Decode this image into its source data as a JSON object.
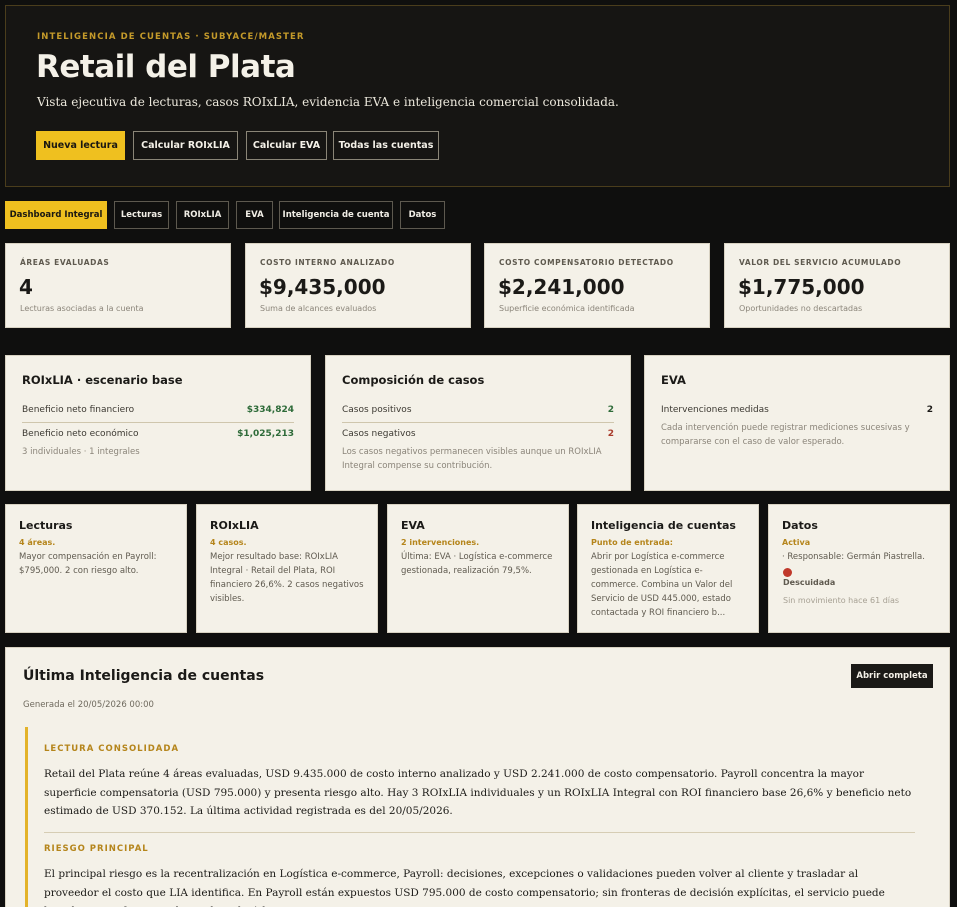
{
  "header": {
    "eyebrow": "INTELIGENCIA DE CUENTAS · SUBYACE/MASTER",
    "title": "Retail del Plata",
    "subtitle": "Vista ejecutiva de lecturas, casos ROIxLIA, evidencia EVA e inteligencia comercial consolidada.",
    "buttons": [
      "Nueva lectura",
      "Calcular ROIxLIA",
      "Calcular EVA",
      "Todas las cuentas"
    ]
  },
  "tabs": [
    "Dashboard Integral",
    "Lecturas",
    "ROIxLIA",
    "EVA",
    "Inteligencia de cuenta",
    "Datos"
  ],
  "kpis": [
    {
      "label": "ÁREAS EVALUADAS",
      "value": "4",
      "note": "Lecturas asociadas a la cuenta"
    },
    {
      "label": "COSTO INTERNO ANALIZADO",
      "value": "$9,435,000",
      "note": "Suma de alcances evaluados"
    },
    {
      "label": "COSTO COMPENSATORIO DETECTADO",
      "value": "$2,241,000",
      "note": "Superficie económica identificada"
    },
    {
      "label": "VALOR DEL SERVICIO ACUMULADO",
      "value": "$1,775,000",
      "note": "Oportunidades no descartadas"
    }
  ],
  "roi_card": {
    "title": "ROIxLIA · escenario base",
    "rows": [
      {
        "label": "Beneficio neto financiero",
        "value": "$334,824"
      },
      {
        "label": "Beneficio neto económico",
        "value": "$1,025,213"
      }
    ],
    "note": "3 individuales · 1 integrales"
  },
  "cases_card": {
    "title": "Composición de casos",
    "rows": [
      {
        "label": "Casos positivos",
        "value": "2"
      },
      {
        "label": "Casos negativos",
        "value": "2"
      }
    ],
    "note": "Los casos negativos permanecen visibles aunque un ROIxLIA Integral compense su contribución."
  },
  "eva_card": {
    "title": "EVA",
    "row": {
      "label": "Intervenciones medidas",
      "value": "2"
    },
    "note": "Cada intervención puede registrar mediciones sucesivas y compararse con el caso de valor esperado."
  },
  "modules": [
    {
      "title": "Lecturas",
      "tag": "4 áreas.",
      "text": "Mayor compensación en Payroll: $795,000. 2 con riesgo alto."
    },
    {
      "title": "ROIxLIA",
      "tag": "4 casos.",
      "text": "Mejor resultado base: ROIxLIA Integral · Retail del Plata, ROI financiero 26,6%. 2 casos negativos visibles."
    },
    {
      "title": "EVA",
      "tag": "2 intervenciones.",
      "text": "Última: EVA · Logística e-commerce gestionada, realización 79,5%."
    },
    {
      "title": "Inteligencia de cuentas",
      "tag": "Punto de entrada:",
      "text": "Abrir por Logística e-commerce gestionada en Logística e-commerce. Combina un Valor del Servicio de USD 445.000, estado contactada y ROI financiero b..."
    }
  ],
  "datos_module": {
    "title": "Datos",
    "tag": "Activa",
    "responsible": "· Responsable: Germán Piastrella.",
    "status": "Descuidada",
    "last_activity": "Sin movimiento hace 61 días",
    "status_color": "#c0392b"
  },
  "intel": {
    "title": "Última Inteligencia de cuentas",
    "generated": "Generada el 20/05/2026 00:00",
    "open_button": "Abrir completa",
    "section1_title": "LECTURA CONSOLIDADA",
    "section1_text": "Retail del Plata reúne 4 áreas evaluadas, USD 9.435.000 de costo interno analizado y USD 2.241.000 de costo compensatorio. Payroll concentra la mayor superficie compensatoria (USD 795.000) y presenta riesgo alto. Hay 3 ROIxLIA individuales y un ROIxLIA Integral con ROI financiero base 26,6% y beneficio neto estimado de USD 370.152. La última actividad registrada es del 20/05/2026.",
    "section2_title": "RIESGO PRINCIPAL",
    "section2_text": "El principal riesgo es la recentralización en Logística e-commerce, Payroll: decisiones, excepciones o validaciones pueden volver al cliente y trasladar al proveedor el costo que LIA identifica. En Payroll están expuestos USD 795.000 de costo compensatorio; sin fronteras de decisión explícitas, el servicio puede heredar ese esfuerzo en lugar de reducirlo."
  }
}
